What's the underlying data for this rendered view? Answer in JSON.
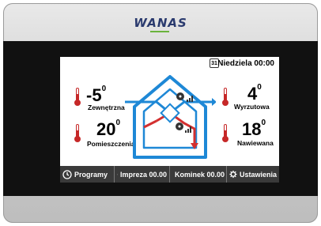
{
  "brand": "WANAS",
  "topbar": {
    "calendar_day": "31",
    "date_label": "Niedziela 00:00"
  },
  "readings": {
    "outside": {
      "value": "-5",
      "unit": "0",
      "label": "Zewnętrzna"
    },
    "exhaust": {
      "value": "4",
      "unit": "0",
      "label": "Wyrzutowa"
    },
    "room": {
      "value": "20",
      "unit": "0",
      "label": "Pomieszczenia"
    },
    "supply": {
      "value": "18",
      "unit": "0",
      "label": "Nawiewana"
    }
  },
  "bottom_bar": {
    "programs": "Programy",
    "party": "Impreza 00.00",
    "fireplace": "Kominek 00.00",
    "settings": "Ustawienia"
  },
  "colors": {
    "house_blue": "#1e88d6",
    "air_red": "#d32f2f",
    "bar_dark": "#3a3a3a",
    "thermometer_red": "#c62828"
  }
}
